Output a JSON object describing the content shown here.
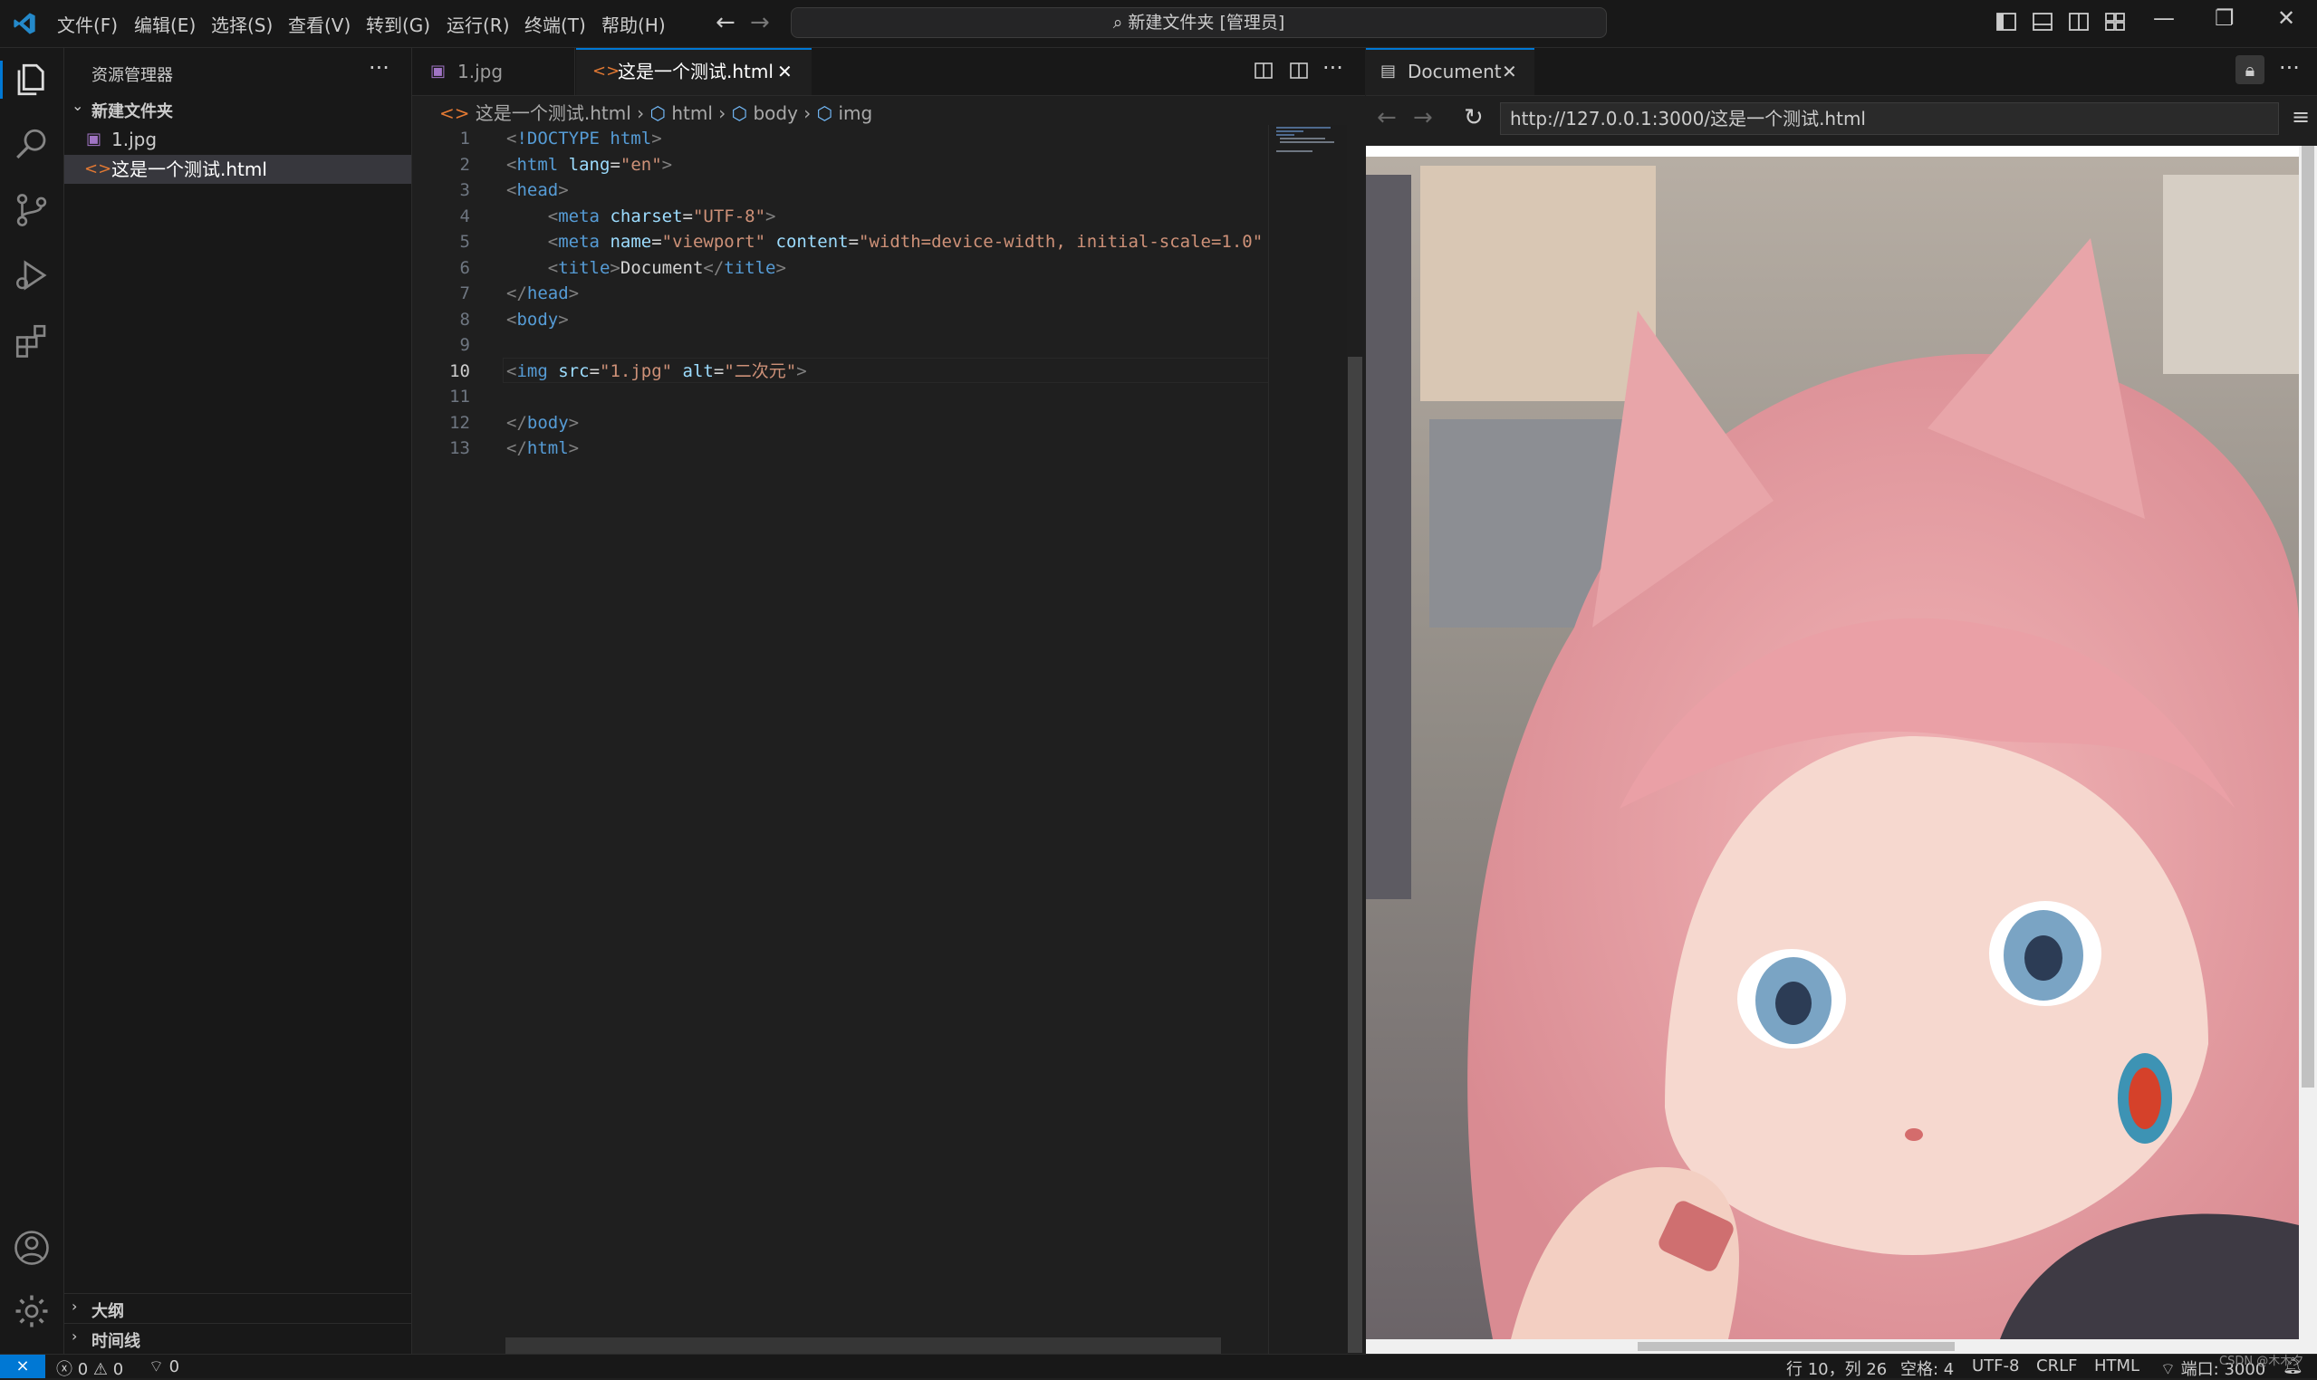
{
  "titlebar": {
    "menus": [
      "文件(F)",
      "编辑(E)",
      "选择(S)",
      "查看(V)",
      "转到(G)",
      "运行(R)",
      "终端(T)",
      "帮助(H)"
    ],
    "search_text": "新建文件夹 [管理员]"
  },
  "sidebar": {
    "title": "资源管理器",
    "folder": "新建文件夹",
    "files": [
      {
        "name": "1.jpg",
        "icon": "image-file-icon"
      },
      {
        "name": "这是一个测试.html",
        "icon": "html-file-icon",
        "selected": true
      }
    ],
    "sections": [
      "大纲",
      "时间线"
    ]
  },
  "editor": {
    "tabs": [
      {
        "label": "1.jpg",
        "active": false
      },
      {
        "label": "这是一个测试.html",
        "active": true
      }
    ],
    "breadcrumb": [
      "这是一个测试.html",
      "html",
      "body",
      "img"
    ],
    "current_line": 10,
    "lines": [
      {
        "n": "1",
        "code": "<!DOCTYPE html>"
      },
      {
        "n": "2",
        "code": "<html lang=\"en\">"
      },
      {
        "n": "3",
        "code": "<head>"
      },
      {
        "n": "4",
        "code": "    <meta charset=\"UTF-8\">"
      },
      {
        "n": "5",
        "code": "    <meta name=\"viewport\" content=\"width=device-width, initial-scale=1.0\""
      },
      {
        "n": "6",
        "code": "    <title>Document</title>"
      },
      {
        "n": "7",
        "code": "</head>"
      },
      {
        "n": "8",
        "code": "<body>"
      },
      {
        "n": "9",
        "code": ""
      },
      {
        "n": "10",
        "code": "<img src=\"1.jpg\" alt=\"二次元\">"
      },
      {
        "n": "11",
        "code": ""
      },
      {
        "n": "12",
        "code": "</body>"
      },
      {
        "n": "13",
        "code": "</html>"
      }
    ]
  },
  "browser": {
    "tab_title": "Document",
    "url": "http://127.0.0.1:3000/这是一个测试.html"
  },
  "statusbar": {
    "errors": "0",
    "warnings": "0",
    "ports_icon_count": "0",
    "cursor": "行 10，列 26",
    "spaces": "空格: 4",
    "encoding": "UTF-8",
    "eol": "CRLF",
    "language": "HTML",
    "port": "端口: 3000",
    "watermark": "CSDN @木木夕"
  },
  "colors": {
    "accent": "#0078d4",
    "background": "#1f1f1f",
    "sidebar": "#181818",
    "html_icon": "#e37933",
    "image_icon": "#a074c4"
  }
}
